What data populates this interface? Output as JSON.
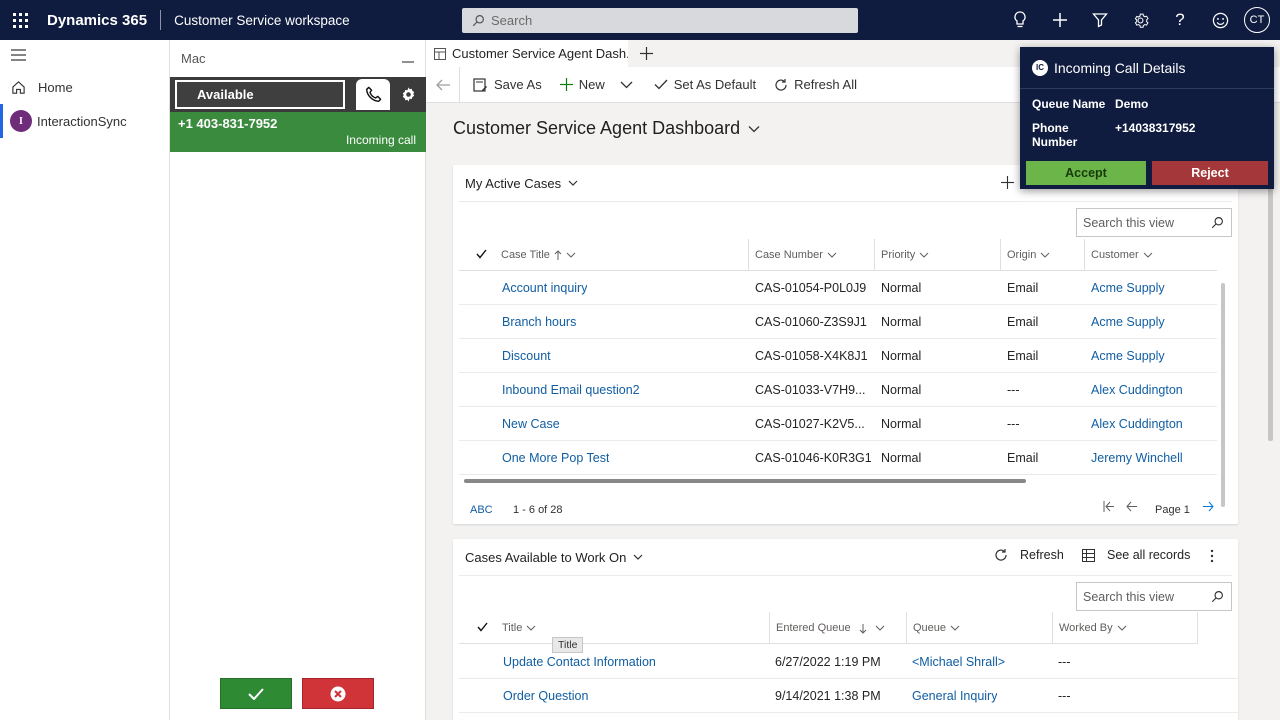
{
  "topbar": {
    "brand": "Dynamics 365",
    "app_name": "Customer Service workspace",
    "search_placeholder": "Search",
    "user_initials": "CT"
  },
  "leftnav": {
    "items": [
      {
        "label": "Home"
      },
      {
        "label": "InteractionSync",
        "badge": "I"
      }
    ]
  },
  "cti": {
    "agent_name": "Mac",
    "status": "Available",
    "caller_number": "+1 403-831-7952",
    "call_state": "Incoming call"
  },
  "tabs": [
    {
      "label": "Customer Service Agent Dash..."
    }
  ],
  "toolbar": {
    "save_as": "Save As",
    "new": "New",
    "set_default": "Set As Default",
    "refresh_all": "Refresh All"
  },
  "dashboard": {
    "title": "Customer Service Agent Dashboard"
  },
  "active_cases": {
    "title": "My Active Cases",
    "search_placeholder": "Search this view",
    "columns": [
      "Case Title",
      "Case Number",
      "Priority",
      "Origin",
      "Customer"
    ],
    "rows": [
      {
        "title": "Account inquiry",
        "number": "CAS-01054-P0L0J9",
        "priority": "Normal",
        "origin": "Email",
        "customer": "Acme Supply"
      },
      {
        "title": "Branch hours",
        "number": "CAS-01060-Z3S9J1",
        "priority": "Normal",
        "origin": "Email",
        "customer": "Acme Supply"
      },
      {
        "title": "Discount",
        "number": "CAS-01058-X4K8J1",
        "priority": "Normal",
        "origin": "Email",
        "customer": "Acme Supply"
      },
      {
        "title": "Inbound Email question2",
        "number": "CAS-01033-V7H9...",
        "priority": "Normal",
        "origin": "---",
        "customer": "Alex Cuddington"
      },
      {
        "title": "New Case",
        "number": "CAS-01027-K2V5...",
        "priority": "Normal",
        "origin": "---",
        "customer": "Alex Cuddington"
      },
      {
        "title": "One More Pop Test",
        "number": "CAS-01046-K0R3G1",
        "priority": "Normal",
        "origin": "Email",
        "customer": "Jeremy Winchell"
      }
    ],
    "footer": {
      "abc": "ABC",
      "range": "1 - 6 of 28",
      "page": "Page 1"
    }
  },
  "available_cases": {
    "title": "Cases Available to Work On",
    "refresh": "Refresh",
    "see_all": "See all records",
    "search_placeholder": "Search this view",
    "columns": [
      "Title",
      "Entered Queue",
      "Queue",
      "Worked By"
    ],
    "tooltip": "Title",
    "rows": [
      {
        "title": "Update Contact Information",
        "entered": "6/27/2022 1:19 PM",
        "queue": "<Michael Shrall>",
        "worked_by": "---"
      },
      {
        "title": "Order Question",
        "entered": "9/14/2021 1:38 PM",
        "queue": "General Inquiry",
        "worked_by": "---"
      }
    ]
  },
  "popup": {
    "logo": "IC",
    "title": "Incoming Call Details",
    "queue_label": "Queue Name",
    "queue_value": "Demo",
    "phone_label": "Phone Number",
    "phone_value": "+14038317952",
    "accept": "Accept",
    "reject": "Reject"
  },
  "colors": {
    "topbar": "#0f1c3f",
    "call_green": "#3b8b3e",
    "accept_green": "#6cb548",
    "reject_red": "#a4373a",
    "link": "#115ea3"
  }
}
